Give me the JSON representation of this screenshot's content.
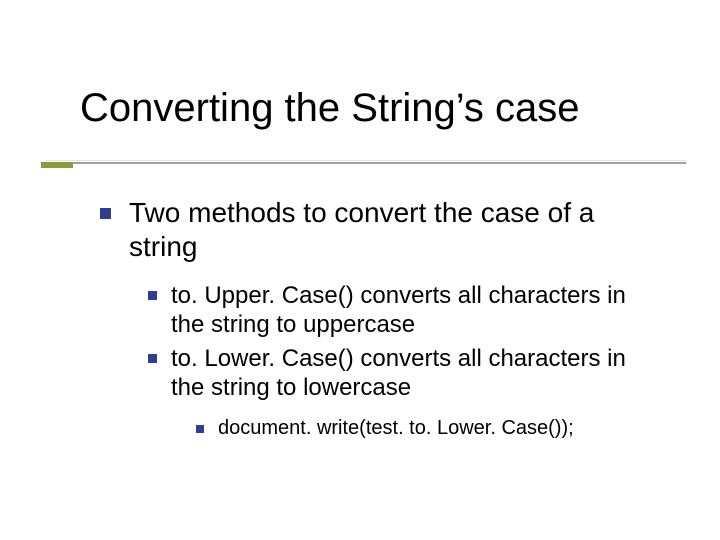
{
  "title": "Converting the String’s case",
  "body": {
    "lvl1": "Two methods to convert the case of a string",
    "lvl2": [
      " to. Upper. Case() converts all characters in the string to uppercase",
      " to. Lower. Case() converts all characters in the string to lowercase"
    ],
    "lvl3": [
      "document. write(test. to. Lower. Case());"
    ]
  },
  "colors": {
    "bullet": "#2f3e8f",
    "accent": "#8e9b3a"
  }
}
